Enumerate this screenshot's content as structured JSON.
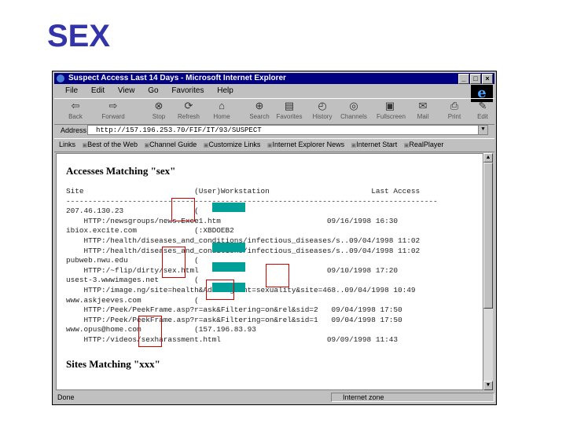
{
  "slide": {
    "title": "SEX"
  },
  "window": {
    "title": "Suspect Access Last 14 Days - Microsoft Internet Explorer",
    "buttons": [
      "_",
      "□",
      "×"
    ],
    "menu": [
      "File",
      "Edit",
      "View",
      "Go",
      "Favorites",
      "Help"
    ],
    "toolbar": [
      "Back",
      "Forward",
      "Stop",
      "Refresh",
      "Home",
      "Search",
      "Favorites",
      "History",
      "Channels",
      "Fullscreen",
      "Mail",
      "Print",
      "Edit"
    ],
    "address_label": "Address",
    "address": "http://157.196.253.70/FIF/IT/93/SUSPECT",
    "links_label": "Links",
    "links": [
      "Best of the Web",
      "Channel Guide",
      "Customize Links",
      "Internet Explorer News",
      "Internet Start",
      "RealPlayer"
    ],
    "status": "Done",
    "zone": "Internet zone"
  },
  "content": {
    "heading1": "Accesses Matching \"sex\"",
    "header_line": "Site                         (User)Workstation                       Last Access",
    "rule_line": "------------------------------------------------------------------------------------",
    "rows": [
      "207.46.130.23                (               ",
      "    HTTP:/newsgroups/news.Exce1.htm                        09/16/1998 16:30",
      "ibiox.excite.com             (:XBDOEB2",
      "    HTTP:/health/diseases_and_conditions/infectious_diseases/s..09/04/1998 11:02",
      "    HTTP:/health/diseases_and_conditions/infectious_diseases/s..09/04/1998 11:02",
      "pubweb.nwu.edu               (               ",
      "    HTTP:/~flip/dirty/sex.html                             09/10/1998 17:20",
      "usest-3.wwwimages.net        (               ",
      "    HTTP:/image.ng/site=health&Ads.Segment=sexuality&site=468..09/04/1998 10:49",
      "www.askjeeves.com            (               ",
      "    HTTP:/Peek/PeekFrame.asp?r=ask&Filtering=on&rel&sid=2   09/04/1998 17:50",
      "    HTTP:/Peek/PeekFrame.asp?r=ask&Filtering=on&rel&sid=1   09/04/1998 17:50",
      "www.opus@home.com            (157.196.83.93",
      "    HTTP:/videos/sexharassment.html                        09/09/1998 11:43"
    ],
    "heading2": "Sites Matching \"xxx\""
  },
  "colors": {
    "highlight": "#00a098",
    "box": "#d00000",
    "title": "#3333aa",
    "titlebar": "#000080"
  }
}
